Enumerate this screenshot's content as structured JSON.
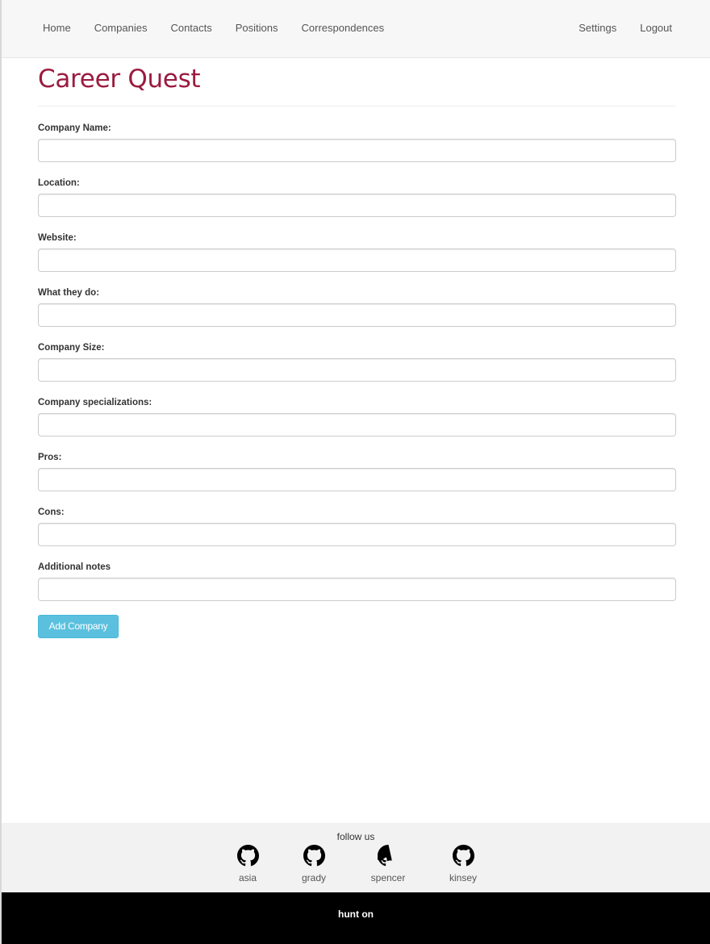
{
  "nav": {
    "left": [
      "Home",
      "Companies",
      "Contacts",
      "Positions",
      "Correspondences"
    ],
    "right": [
      "Settings",
      "Logout"
    ]
  },
  "page": {
    "title": "Career Quest"
  },
  "form": {
    "fields": [
      {
        "label": "Company Name:",
        "value": "",
        "placeholder": ""
      },
      {
        "label": "Location:",
        "value": "",
        "placeholder": ""
      },
      {
        "label": "Website:",
        "value": "",
        "placeholder": ""
      },
      {
        "label": "What they do:",
        "value": "",
        "placeholder": ""
      },
      {
        "label": "Company Size:",
        "value": "",
        "placeholder": ""
      },
      {
        "label": "Company specializations:",
        "value": "",
        "placeholder": ""
      },
      {
        "label": "Pros:",
        "value": "",
        "placeholder": ""
      },
      {
        "label": "Cons:",
        "value": "",
        "placeholder": ""
      },
      {
        "label": "Additional notes",
        "value": "",
        "placeholder": ""
      }
    ],
    "submit_label": "Add Company"
  },
  "footer": {
    "follow_text": "follow us",
    "links": [
      {
        "name": "asia",
        "icon": "github-icon"
      },
      {
        "name": "grady",
        "icon": "github-icon"
      },
      {
        "name": "spencer",
        "icon": "github-icon"
      },
      {
        "name": "kinsey",
        "icon": "github-icon"
      }
    ],
    "bottom_text": "hunt on"
  },
  "colors": {
    "title": "#9b1b3f",
    "button": "#5bc0de",
    "bottom_bar": "#000000"
  }
}
